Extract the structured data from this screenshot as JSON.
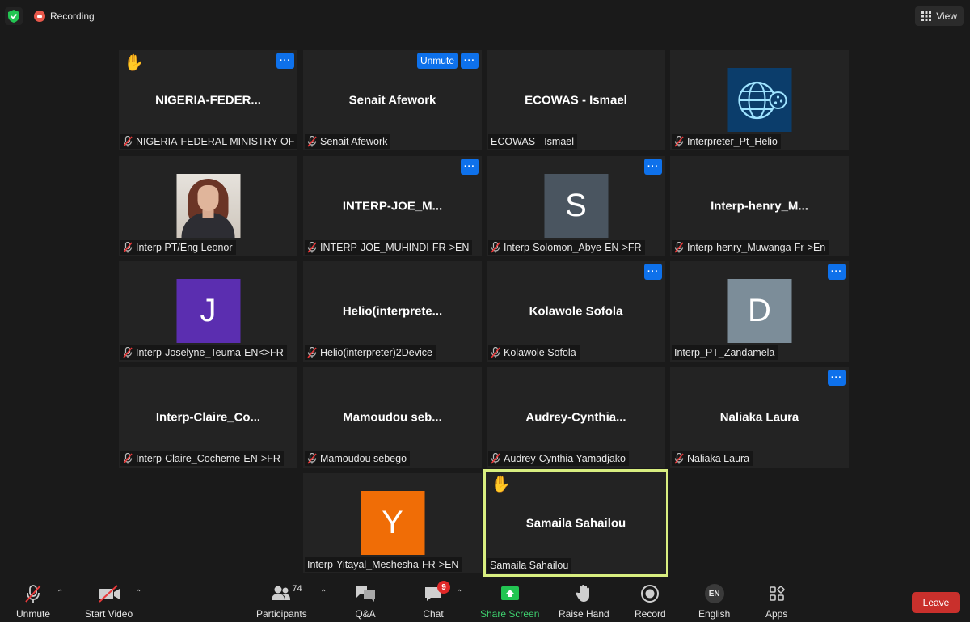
{
  "topbar": {
    "recording_label": "Recording",
    "view_label": "View"
  },
  "tiles": [
    {
      "center": "NIGERIA-FEDER...",
      "label": "NIGERIA-FEDERAL MINISTRY OF ...",
      "muted": true,
      "hand": true,
      "more": true
    },
    {
      "center": "Senait Afework",
      "label": "Senait Afework",
      "muted": true,
      "unmute": "Unmute",
      "more": true
    },
    {
      "center": "ECOWAS - Ismael",
      "label": "ECOWAS - Ismael",
      "muted": false
    },
    {
      "center": "",
      "label": "Interpreter_Pt_Helio",
      "muted": true,
      "avatar_type": "globe"
    },
    {
      "center": "",
      "label": "Interp PT/Eng Leonor",
      "muted": true,
      "avatar_type": "photo"
    },
    {
      "center": "INTERP-JOE_M...",
      "label": "INTERP-JOE_MUHINDI-FR->EN",
      "muted": true,
      "more": true
    },
    {
      "center": "",
      "label": "Interp-Solomon_Abye-EN->FR",
      "muted": true,
      "more": true,
      "avatar_letter": "S",
      "avatar_color": "#4a5560"
    },
    {
      "center": "Interp-henry_M...",
      "label": "Interp-henry_Muwanga-Fr->En",
      "muted": true
    },
    {
      "center": "",
      "label": "Interp-Joselyne_Teuma-EN<>FR",
      "muted": true,
      "avatar_letter": "J",
      "avatar_color": "#5b2eb0"
    },
    {
      "center": "Helio(interprete...",
      "label": "Helio(interpreter)2Device",
      "muted": true
    },
    {
      "center": "Kolawole Sofola",
      "label": "Kolawole Sofola",
      "muted": true,
      "more": true
    },
    {
      "center": "",
      "label": "Interp_PT_Zandamela",
      "muted": false,
      "more": true,
      "avatar_letter": "D",
      "avatar_color": "#7c8d99"
    },
    {
      "center": "Interp-Claire_Co...",
      "label": "Interp-Claire_Cocheme-EN->FR",
      "muted": true
    },
    {
      "center": "Mamoudou  seb...",
      "label": "Mamoudou sebego",
      "muted": true
    },
    {
      "center": "Audrey-Cynthia...",
      "label": "Audrey-Cynthia Yamadjako",
      "muted": true
    },
    {
      "center": "Naliaka Laura",
      "label": "Naliaka Laura",
      "muted": true,
      "more": true
    },
    {
      "center": "",
      "label": "Interp-Yitayal_Meshesha-FR->EN",
      "muted": false,
      "avatar_letter": "Y",
      "avatar_color": "#f06d06"
    },
    {
      "center": "Samaila Sahailou",
      "label": "Samaila Sahailou",
      "muted": false,
      "hand": true,
      "active": true
    }
  ],
  "more_symbol": "···",
  "toolbar": {
    "unmute": "Unmute",
    "start_video": "Start Video",
    "participants": "Participants",
    "participants_count": "74",
    "qa": "Q&A",
    "chat": "Chat",
    "chat_badge": "9",
    "share_screen": "Share Screen",
    "raise_hand": "Raise Hand",
    "record": "Record",
    "language": "English",
    "language_code": "EN",
    "apps": "Apps",
    "leave": "Leave"
  },
  "colors": {
    "accent_blue": "#0e71eb",
    "share_green": "#3ecf6e",
    "leave_red": "#c9302c",
    "active_border": "#d8ee80"
  }
}
